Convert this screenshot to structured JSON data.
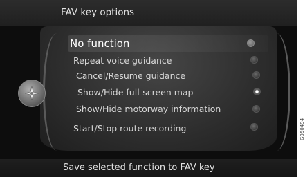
{
  "header": {
    "title": "FAV key options"
  },
  "menu": {
    "items": [
      {
        "label": "No function",
        "state": "highlighted"
      },
      {
        "label": "Repeat voice guidance",
        "state": "off"
      },
      {
        "label": "Cancel/Resume guidance",
        "state": "off"
      },
      {
        "label": "Show/Hide full-screen map",
        "state": "on"
      },
      {
        "label": "Show/Hide motorway information",
        "state": "off"
      },
      {
        "label": "Start/Stop route recording",
        "state": "off"
      }
    ]
  },
  "footer": {
    "hint": "Save selected function to FAV key"
  },
  "image_code": "G050494",
  "colors": {
    "background": "#0d0d0d",
    "text": "#d6d6d6",
    "highlight_text": "#ffffff"
  },
  "icons": {
    "knob": "navigation-knob-icon"
  }
}
